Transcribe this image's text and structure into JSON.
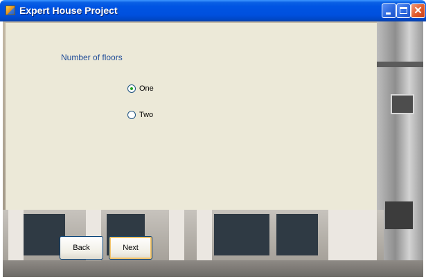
{
  "window": {
    "title": "Expert House Project",
    "icon": "app-icon",
    "controls": {
      "minimize": "minimize-icon",
      "maximize": "maximize-icon",
      "close": "close-icon",
      "close_glyph": "✕"
    }
  },
  "form": {
    "heading": "Number of floors",
    "options": [
      {
        "label": "One",
        "selected": true
      },
      {
        "label": "Two",
        "selected": false
      }
    ]
  },
  "buttons": {
    "back": "Back",
    "next": "Next"
  },
  "colors": {
    "titlebar": "#0054e3",
    "panel": "#ece9d8",
    "heading": "#1e4b97"
  }
}
